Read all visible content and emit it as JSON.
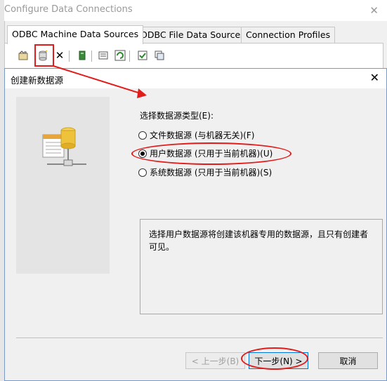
{
  "background_window": {
    "title": "Configure Data Connections",
    "close_glyph": "✕",
    "tabs": [
      {
        "label": "ODBC Machine Data Sources",
        "active": true
      },
      {
        "label": "ODBC File Data Sources",
        "active": false
      },
      {
        "label": "Connection Profiles",
        "active": false
      }
    ],
    "toolbar_icons": [
      "configure-icon",
      "new-data-source-icon",
      "delete-icon",
      "test-connection-icon",
      "browse-icon",
      "refresh-icon",
      "checklist-icon",
      "copy-icon"
    ]
  },
  "dialog": {
    "title": "创建新数据源",
    "close_glyph": "✕",
    "prompt": "选择数据源类型(E):",
    "options": [
      {
        "label": "文件数据源 (与机器无关)(F)",
        "selected": false
      },
      {
        "label": "用户数据源 (只用于当前机器)(U)",
        "selected": true
      },
      {
        "label": "系统数据源 (只用于当前机器)(S)",
        "selected": false
      }
    ],
    "description": "选择用户数据源将创建该机器专用的数据源，且只有创建者可见。",
    "buttons": {
      "back": "< 上一步(B)",
      "next": "下一步(N) >",
      "cancel": "取消"
    }
  },
  "annotation_color": "#e21b1b"
}
